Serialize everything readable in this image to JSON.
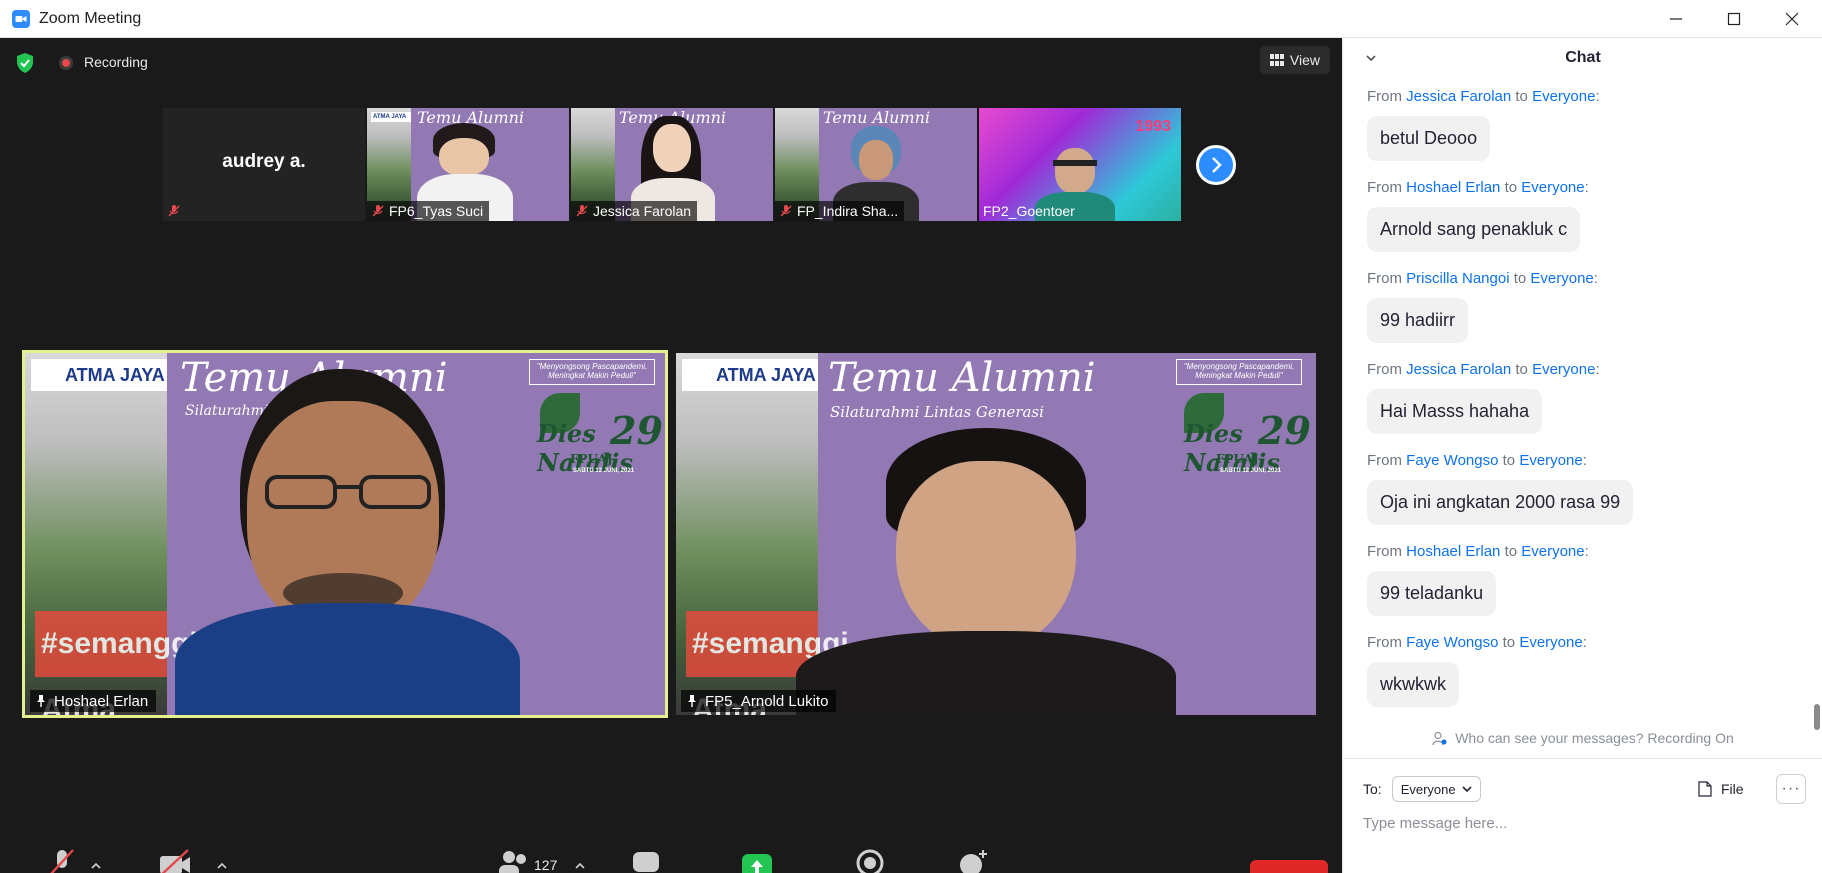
{
  "window": {
    "title": "Zoom Meeting",
    "icon": "zoom-camera-icon"
  },
  "meeting": {
    "recording_label": "Recording",
    "view_label": "View",
    "strip": [
      {
        "name": "audrey a.",
        "muted": true,
        "video": false
      },
      {
        "name": "FP6_Tyas Suci",
        "muted": true,
        "video": true
      },
      {
        "name": "Jessica Farolan",
        "muted": true,
        "video": true
      },
      {
        "name": "FP_Indira Sha...",
        "muted": true,
        "video": true
      },
      {
        "name": "FP2_Goentoer",
        "muted": false,
        "video": true
      }
    ],
    "strip_badge_year": "1993",
    "main_videos": [
      {
        "name": "Hoshael Erlan",
        "active": true
      },
      {
        "name": "FP5_Arnold Lukito",
        "active": false
      }
    ],
    "background": {
      "brand": "ATMA JAYA",
      "title": "Temu Alumni",
      "subtitle": "Silaturahmi Lintas Generasi",
      "motto": "\"Menyongsong Pascapandemi, Meningkat Makin Peduli\"",
      "dies": "Dies Natalis",
      "dies_number": "29",
      "dies_org": "FPUAJ",
      "date": "SABTU 12 JUNI, 2021",
      "sign": "#semanggi Atma"
    },
    "participants_count": "127",
    "accent": "#2d8cff",
    "active_speaker_outline": "#e6f08f"
  },
  "chat": {
    "title": "Chat",
    "messages": [
      {
        "from": "Jessica Farolan",
        "to": "Everyone",
        "text": "betul Deooo"
      },
      {
        "from": "Hoshael Erlan",
        "to": "Everyone",
        "text": "Arnold sang penakluk c"
      },
      {
        "from": "Priscilla Nangoi",
        "to": "Everyone",
        "text": "99 hadiirr"
      },
      {
        "from": "Jessica Farolan",
        "to": "Everyone",
        "text": "Hai Masss hahaha"
      },
      {
        "from": "Faye Wongso",
        "to": "Everyone",
        "text": "Oja ini angkatan 2000 rasa 99"
      },
      {
        "from": "Hoshael Erlan",
        "to": "Everyone",
        "text": "99 teladanku"
      },
      {
        "from": "Faye Wongso",
        "to": "Everyone",
        "text": "wkwkwk"
      }
    ],
    "from_word": "From",
    "to_word": "to",
    "privacy_notice": "Who can see your messages? Recording On",
    "to_label": "To:",
    "recipient": "Everyone",
    "file_label": "File",
    "more_label": "···",
    "input_placeholder": "Type message here..."
  }
}
